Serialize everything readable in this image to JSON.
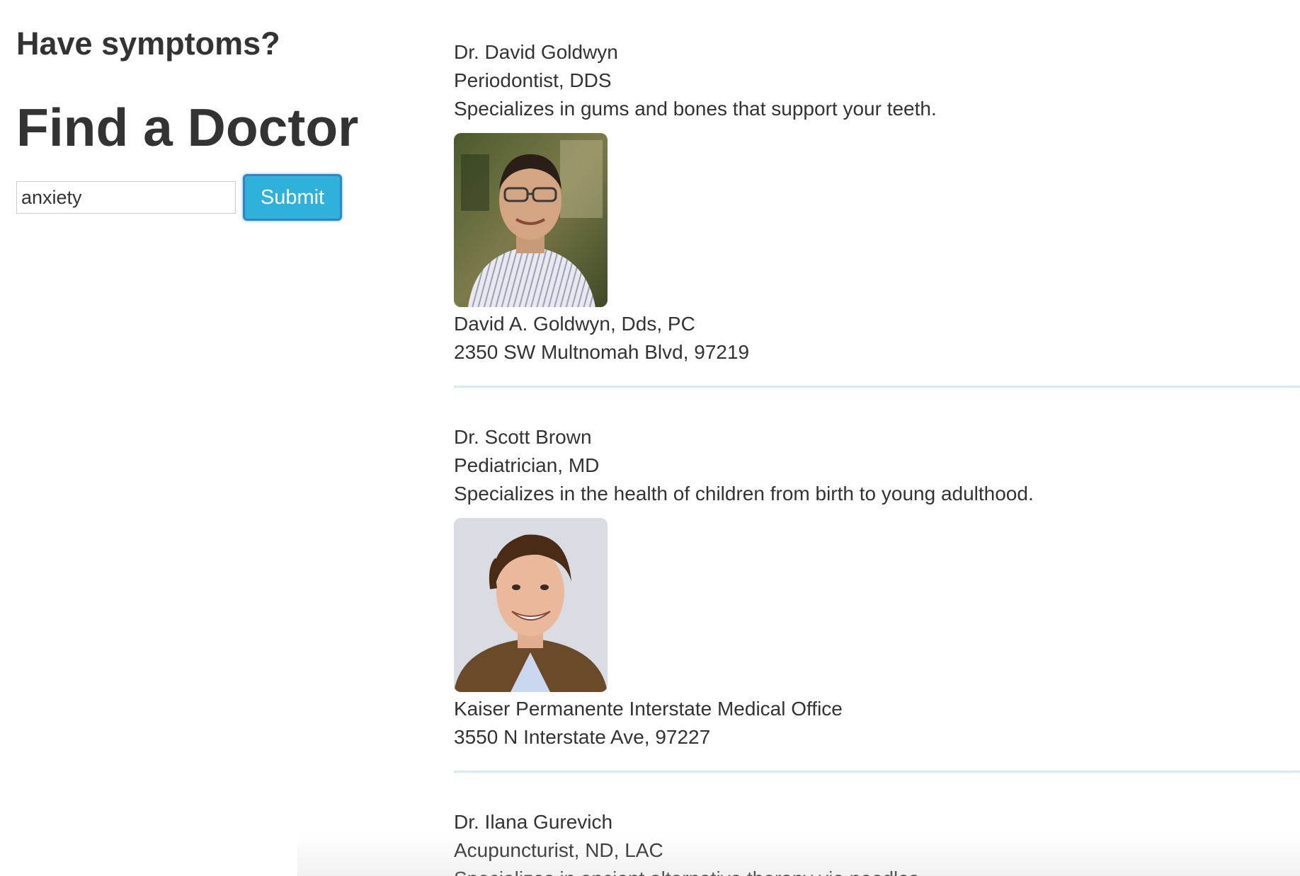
{
  "search_panel": {
    "subheading": "Have symptoms?",
    "heading": "Find a Doctor",
    "input_value": "anxiety",
    "submit_label": "Submit"
  },
  "doctors": [
    {
      "name": "Dr. David Goldwyn",
      "title": "Periodontist, DDS",
      "description": "Specializes in gums and bones that support your teeth.",
      "practice": "David A. Goldwyn, Dds, PC",
      "address": "2350 SW Multnomah Blvd, 97219"
    },
    {
      "name": "Dr. Scott Brown",
      "title": "Pediatrician, MD",
      "description": "Specializes in the health of children from birth to young adulthood.",
      "practice": "Kaiser Permanente Interstate Medical Office",
      "address": "3550 N Interstate Ave, 97227"
    },
    {
      "name": "Dr. Ilana Gurevich",
      "title": "Acupuncturist, ND, LAC",
      "description": "Specializes in ancient alternative therapy via needles."
    }
  ],
  "colors": {
    "submit_bg": "#2eb2d9",
    "divider": "#d6ebf7",
    "text": "#333333"
  }
}
